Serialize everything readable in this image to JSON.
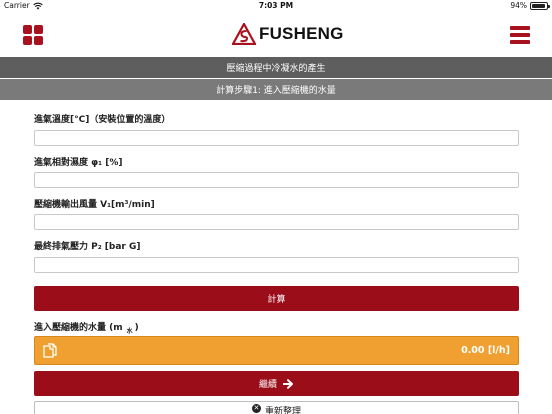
{
  "status_bar": {
    "carrier": "Carrier",
    "time": "7:03 PM",
    "battery_percent": "94%",
    "battery_level": 0.94
  },
  "header": {
    "logo_text": "FUSHENG",
    "brand_color": "#a8121f",
    "menu_icon": "hamburger-menu-icon",
    "apps_icon": "grid-icon"
  },
  "banners": {
    "title": "壓縮過程中冷凝水的產生",
    "step": "計算步驟1:  進入壓縮機的水量"
  },
  "fields": [
    {
      "label": "進氣溫度[°C]（安裝位置的溫度）",
      "value": "",
      "placeholder": ""
    },
    {
      "label": "進氣相對濕度 φ₁ [%]",
      "value": "",
      "placeholder": ""
    },
    {
      "label": "壓縮機輸出風量 V₁[m³/min]",
      "value": "",
      "placeholder": ""
    },
    {
      "label": "最終排氣壓力 P₂ [bar G]",
      "value": "",
      "placeholder": ""
    }
  ],
  "calculate_label": "計算",
  "result": {
    "label": "進入壓縮機的水量 (m",
    "label_sub": "水",
    "label_close": ")",
    "value": "0.00 [l/h]",
    "box_color": "#f0a030",
    "copy_icon": "copy-icon"
  },
  "continue_label": "繼續",
  "reset_label": "重新整理"
}
